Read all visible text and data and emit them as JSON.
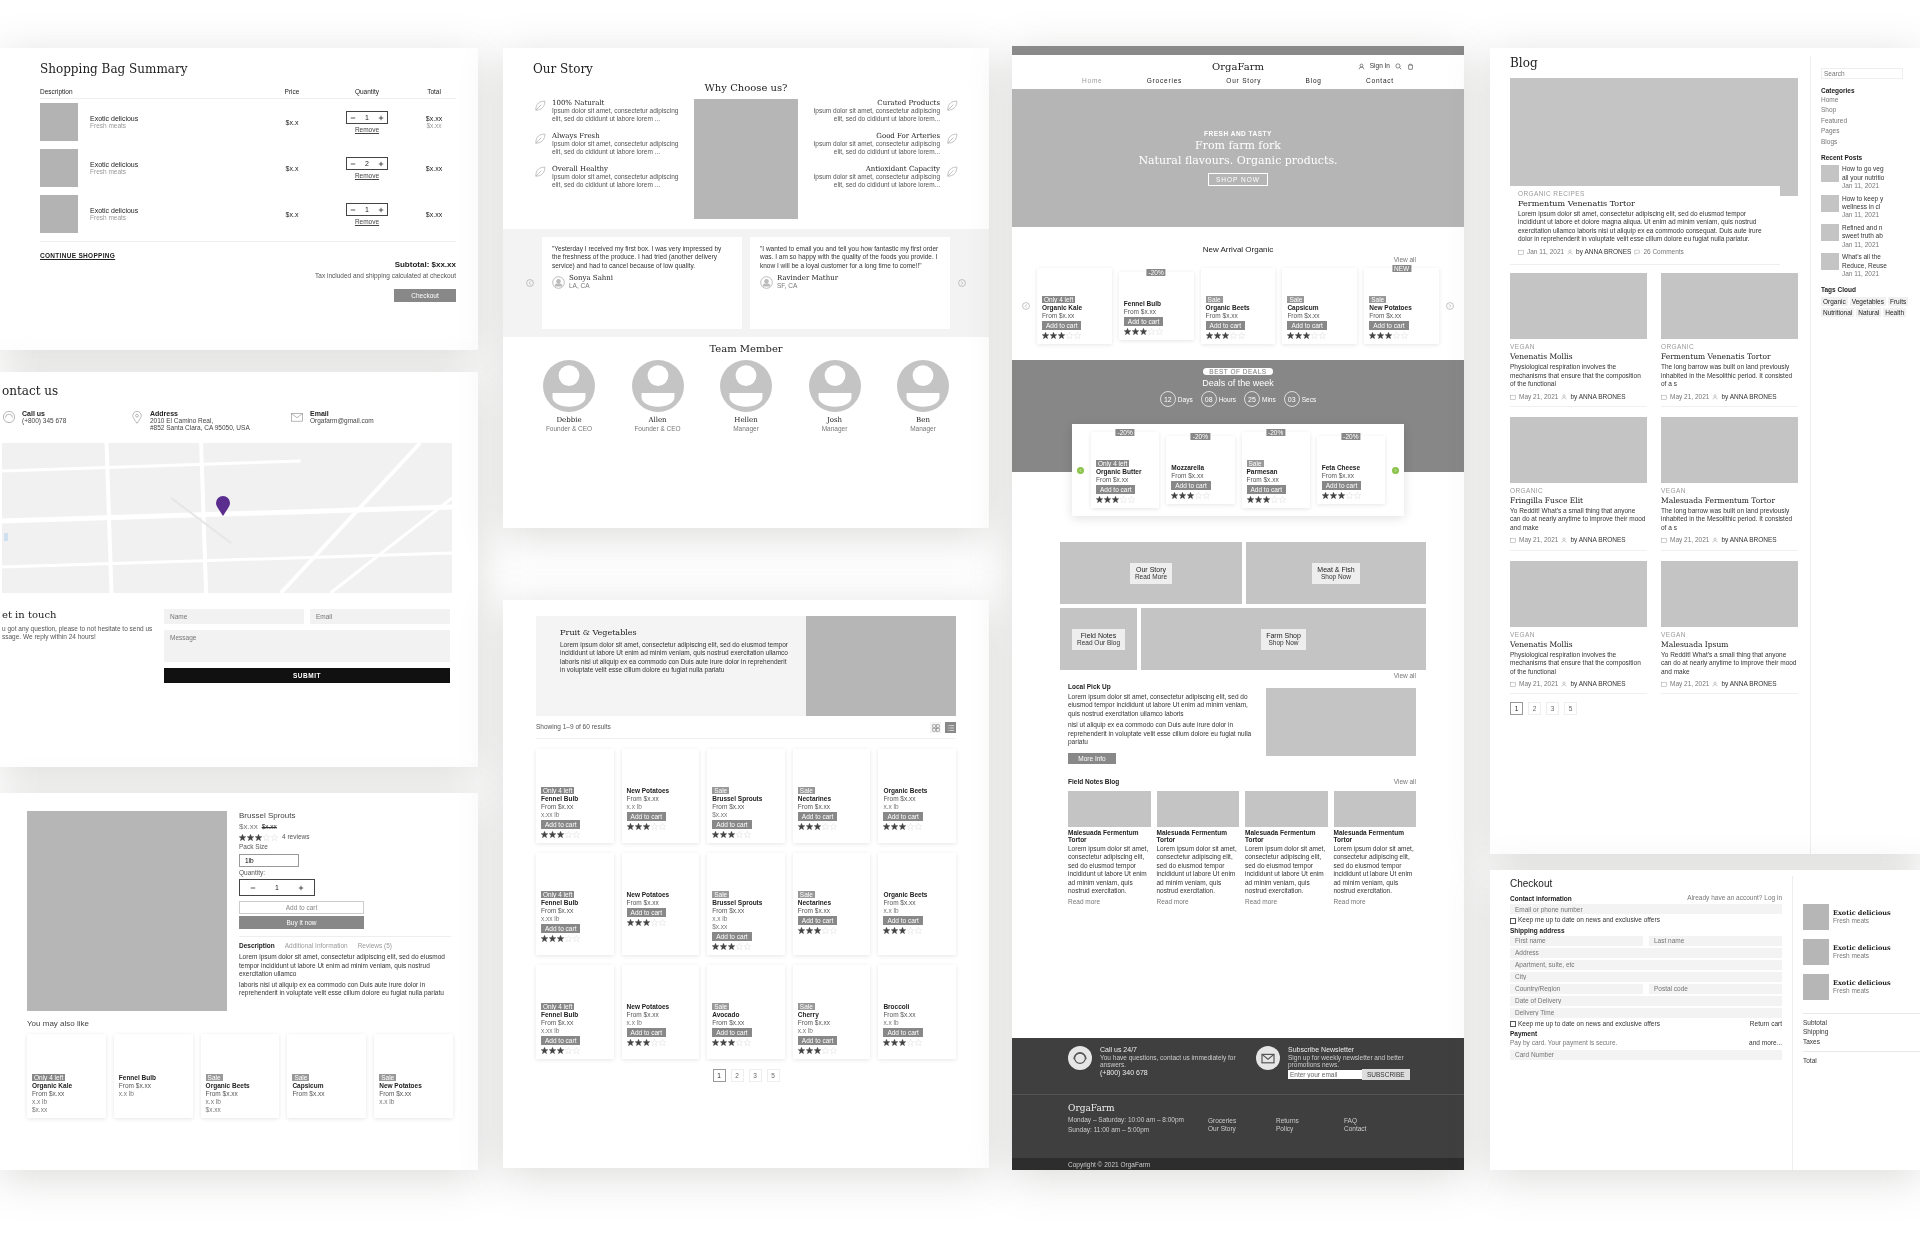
{
  "cart": {
    "title": "Shopping Bag Summary",
    "columns": [
      "Description",
      "Price",
      "Quantity",
      "Total"
    ],
    "items": [
      {
        "name": "Exotic delicious",
        "sub": "Fresh meats",
        "price": "$x.x",
        "qty": "1",
        "remove": "Remove",
        "total": "$x.xx",
        "old": "$x.xx"
      },
      {
        "name": "Exotic delicious",
        "sub": "Fresh meats",
        "price": "$x.x",
        "qty": "2",
        "remove": "Remove",
        "total": "$x.xx"
      },
      {
        "name": "Exotic delicious",
        "sub": "Fresh meats",
        "price": "$x.x",
        "qty": "1",
        "remove": "Remove",
        "total": "$x.xx"
      }
    ],
    "continue": "CONTINUE SHOPPING",
    "subtotal": "Subtotal: $xx.xx",
    "note": "Tax included and shipping calculated at checkout",
    "checkout": "Checkout"
  },
  "contact": {
    "title": "ontact us",
    "infos": [
      {
        "kind": "phone",
        "label": "Call us",
        "lines": [
          "(+800) 345 678"
        ]
      },
      {
        "kind": "pin",
        "label": "Address",
        "lines": [
          "2010 El Camino Real,",
          "#852 Santa Clara, CA 95050, USA"
        ]
      },
      {
        "kind": "mail",
        "label": "Email",
        "lines": [
          "Orgafarm@gmail.com"
        ]
      }
    ],
    "touch_title": "et in touch",
    "touch_text": "u got any question, please to not hesitate to send us ssage. We reply within 24 hours!",
    "name_placeholder": "Name",
    "email_placeholder": "Email",
    "message_placeholder": "Message",
    "submit": "SUBMIT"
  },
  "product": {
    "name": "Brussel Sprouts",
    "price": "$x.xx",
    "old_price": "$x.xx",
    "stars": 3,
    "reviews": "4 reviews",
    "pack_label": "Pack Size",
    "pack_value": "1lb",
    "qty_label": "Quantity:",
    "qty": "1",
    "add": "Add to cart",
    "buy": "Buy it now",
    "tabs": [
      {
        "label": "Description",
        "selected": true
      },
      {
        "label": "Additional Information",
        "selected": false
      },
      {
        "label": "Reviews (5)",
        "selected": false
      }
    ],
    "paragraphs": [
      "Lorem ipsum dolor sit amet, consectetur adipiscing elit, sed do eiusmod tempor incididunt ut labore Ut enim ad minim veniam, quis nostrud exercitation ullamco",
      "laboris nisi ut aliquip ex ea commodo con Duis aute irure dolor in reprehenderit in voluptate velit esse cillum dolore eu fugiat nulla pariatu"
    ],
    "related_title": "You may also like",
    "related": [
      {
        "badge": "Only 4 left",
        "name": "Organic Kale",
        "price": "From $x.xx",
        "weight": "x.x lb",
        "old": "$x.xx"
      },
      {
        "name": "Fennel Bulb",
        "price": "From $x.xx",
        "weight": "x.x lb"
      },
      {
        "badge": "Sale",
        "name": "Organic Beets",
        "price": "From $x.xx",
        "weight": "x.x lb",
        "old": "$x.xx"
      },
      {
        "badge": "Sale",
        "name": "Capsicum",
        "price": "From $x.xx"
      },
      {
        "badge": "Sale",
        "name": "New Potatoes",
        "price": "From $x.xx",
        "weight": "x.x lb"
      }
    ]
  },
  "story": {
    "title": "Our Story",
    "why": "Why  Choose us?",
    "features": [
      {
        "kind": "left",
        "title": "100% Naturalt",
        "text": "Ipsum dolor sit amet, consectetur adipiscing elit, sed do cididunt ut labore lorem ..."
      },
      {
        "kind": "left",
        "title": "Always Fresh",
        "text": "Ipsum dolor sit amet, consectetur adipiscing elit, sed do cididunt ut labore lorem ..."
      },
      {
        "kind": "left",
        "title": "Overall Healthy",
        "text": "Ipsum dolor sit amet, consectetur adipiscing elit, sed do cididunt ut labore lorem ..."
      },
      {
        "kind": "right",
        "title": "Curated Products",
        "text": "Ipsum dolor sit amet, consectetur adipiscing elit, sed do cididunt ut labore lorem..."
      },
      {
        "kind": "right",
        "title": "Good For Arteries",
        "text": "Ipsum dolor sit amet, consectetur adipiscing elit, sed do cididunt ut labore lorem..."
      },
      {
        "kind": "right",
        "title": "Antioxidant Capacity",
        "text": "Ipsum dolor sit amet, consectetur adipiscing elit, sed do cididunt ut labore lorem..."
      }
    ],
    "testimonials": [
      {
        "quote": "\"Yesterday I received my first box. I was very impressed by the freshness of the produce. I had tried (another delivery service) and had to cancel because of low quality.",
        "name": "Sonya Sahni",
        "place": "LA, CA"
      },
      {
        "quote": "\"I wanted to email you and tell you how fantastic my first order was. I am so happy with the quality of the foods you provide. I know I will be a loyal customer for a long time to come!!\"",
        "name": "Ravinder Mathur",
        "place": "SF, CA"
      }
    ],
    "team_title": "Team Member",
    "team": [
      {
        "name": "Debbie",
        "role": "Founder & CEO"
      },
      {
        "name": "Allen",
        "role": "Founder & CEO"
      },
      {
        "name": "Hellen",
        "role": "Manager"
      },
      {
        "name": "Josh",
        "role": "Manager"
      },
      {
        "name": "Ben",
        "role": "Manager"
      }
    ]
  },
  "shop": {
    "banner_title": "Fruit & Vegetables",
    "banner_text": "Lorem ipsum dolor sit amet, consectetur adipiscing elit, sed do eiusmod tempor incididunt ut labore Ut enim ad minim veniam, quis nostrud exercitation ullamco laboris nisi ut aliquip ex ea commodo con Duis aute irure dolor in reprehenderit in voluptate velit esse cillum dolore eu fugiat nulla pariatu",
    "results": "Showing 1–9 of 60 results",
    "views": [
      {
        "kind": "grid",
        "selected": false
      },
      {
        "kind": "list",
        "selected": true
      }
    ],
    "products": [
      {
        "badge": "Only 4 left",
        "name": "Fennel Bulb",
        "price": "From $x.xx",
        "weight": "x.xx lb",
        "button": "Add to cart",
        "stars": 3
      },
      {
        "name": "New Potatoes",
        "price": "From $x.xx",
        "weight": "x.x lb",
        "button": "Add to cart",
        "stars": 3
      },
      {
        "badge": "Sale",
        "name": "Brussel Sprouts",
        "price": "From $x.xx",
        "old": "$x.xx",
        "button": "Add to cart",
        "stars": 3
      },
      {
        "badge": "Sale",
        "name": "Nectarines",
        "price": "From $x.xx",
        "button": "Add to cart",
        "stars": 3
      },
      {
        "name": "Organic Beets",
        "price": "From $x.xx",
        "weight": "x.x lb",
        "button": "Add to cart",
        "stars": 3
      },
      {
        "badge": "Only 4 left",
        "name": "Fennel Bulb",
        "price": "From $x.xx",
        "weight": "x.xx lb",
        "button": "Add to cart",
        "stars": 3
      },
      {
        "name": "New Potatoes",
        "price": "From $x.xx",
        "button": "Add to cart",
        "stars": 3
      },
      {
        "badge": "Sale",
        "name": "Brussel Sprouts",
        "price": "From $x.xx",
        "weight": "x.x lb",
        "old": "$x.xx",
        "button": "Add to cart",
        "stars": 3
      },
      {
        "badge": "Sale",
        "name": "Nectarines",
        "price": "From $x.xx",
        "button": "Add to cart",
        "stars": 3
      },
      {
        "name": "Organic Beets",
        "price": "From $x.xx",
        "weight": "x.x lb",
        "button": "Add to cart",
        "stars": 3
      },
      {
        "badge": "Only 4 left",
        "name": "Fennel Bulb",
        "price": "From $x.xx",
        "weight": "x.xx lb",
        "button": "Add to cart",
        "stars": 3
      },
      {
        "name": "New Potatoes",
        "price": "From $x.xx",
        "weight": "x.x lb",
        "button": "Add to cart",
        "stars": 3
      },
      {
        "badge": "Sale",
        "name": "Avocado",
        "price": "From $x.xx",
        "button": "Add to cart",
        "stars": 3
      },
      {
        "badge": "Sale",
        "name": "Cherry",
        "price": "From $x.xx",
        "weight": "x.x lb",
        "button": "Add to cart",
        "stars": 3
      },
      {
        "name": "Broccoli",
        "price": "From $x.xx",
        "weight": "x.x lb",
        "button": "Add to cart",
        "stars": 3
      }
    ],
    "pages": [
      {
        "label": "1",
        "selected": true
      },
      {
        "label": "2",
        "selected": false
      },
      {
        "label": "3",
        "selected": false
      },
      {
        "label": "5",
        "selected": false
      }
    ]
  },
  "home": {
    "brand": "OrgaFarm",
    "sign_in": "Sign In",
    "nav": [
      {
        "label": "Home",
        "selected": true
      },
      {
        "label": "Groceries",
        "selected": false
      },
      {
        "label": "Our Story",
        "selected": false
      },
      {
        "label": "Blog",
        "selected": false
      },
      {
        "label": "Contact",
        "selected": false
      }
    ],
    "hero_eyebrow": "FRESH AND TASTY",
    "hero_lines": [
      "From farm fork",
      "Natural flavours. Organic products."
    ],
    "hero_button": "SHOP NOW",
    "arrivals_title": "New Arrival Organic",
    "arrivals_view_all": "View all",
    "arrivals": [
      {
        "badge": "Only 4 left",
        "name": "Organic Kale",
        "price": "From $x.xx",
        "button": "Add to cart",
        "stars": 3
      },
      {
        "tag": "-20%",
        "name": "Fennel Bulb",
        "price": "From $x.xx",
        "button": "Add to cart",
        "stars": 3
      },
      {
        "badge": "Sale",
        "name": "Organic Beets",
        "price": "From $x.xx",
        "button": "Add to cart",
        "stars": 3
      },
      {
        "badge": "Sale",
        "name": "Capsicum",
        "price": "From $x.xx",
        "button": "Add to cart",
        "stars": 3
      },
      {
        "badge": "Sale",
        "tag": "NEW",
        "name": "New Potatoes",
        "price": "From $x.xx",
        "button": "Add to cart",
        "stars": 3
      }
    ],
    "deals_pill": "BEST OF DEALS",
    "deals_title": "Deals of the week",
    "countdown": [
      {
        "value": "12",
        "unit": "Days"
      },
      {
        "value": "08",
        "unit": "Hours"
      },
      {
        "value": "25",
        "unit": "Mins"
      },
      {
        "value": "03",
        "unit": "Secs"
      }
    ],
    "deals": [
      {
        "tag": "-20%",
        "badge": "Only 4 left",
        "name": "Organic Butter",
        "price": "From $x.xx",
        "button": "Add to cart",
        "stars": 3
      },
      {
        "tag": "-20%",
        "name": "Mozzarella",
        "price": "From $x.xx",
        "button": "Add to cart",
        "stars": 3
      },
      {
        "tag": "-20%",
        "badge": "Sale",
        "name": "Parmesan",
        "price": "From $x.xx",
        "button": "Add to cart",
        "stars": 3
      },
      {
        "tag": "-20%",
        "name": "Feta Cheese",
        "price": "From $x.xx",
        "button": "Add to cart",
        "stars": 3
      }
    ],
    "tiles": [
      {
        "title": "Our Story",
        "sub": "Read More"
      },
      {
        "title": "Meat & Fish",
        "sub": "Shop Now"
      },
      {
        "title": "Field Notes",
        "sub": "Read Our Blog"
      },
      {
        "title": "Farm Shop",
        "sub": "Shop Now"
      }
    ],
    "tiles_view_all": "View all",
    "pickup_title": "Local Pick Up",
    "pickup_paragraphs": [
      "Lorem ipsum dolor sit amet, consectetur adipiscing elit, sed do eiusmod tempor incididunt ut labore Ut enim ad minim veniam, quis nostrud exercitation ullamco laboris",
      "nisi ut aliquip ex ea commodo con Duis aute irure dolor in reprehenderit in voluptate velit esse cillum dolore eu fugiat nulla pariatu"
    ],
    "pickup_button": "More Info",
    "blog_title": "Field Notes Blog",
    "blog_view_all": "View all",
    "posts": [
      {
        "title": "Malesuada Fermentum Tortor",
        "text": "Lorem ipsum dolor sit amet, consectetur adipiscing elit, sed do eiusmod tempor incididunt ut labore Ut enim ad minim veniam, quis nostrud exercitation.",
        "read_more": "Read more"
      },
      {
        "title": "Malesuada Fermentum Tortor",
        "text": "Lorem ipsum dolor sit amet, consectetur adipiscing elit, sed do eiusmod tempor incididunt ut labore Ut enim ad minim veniam, quis nostrud exercitation.",
        "read_more": "Read more"
      },
      {
        "title": "Malesuada Fermentum Tortor",
        "text": "Lorem ipsum dolor sit amet, consectetur adipiscing elit, sed do eiusmod tempor incididunt ut labore Ut enim ad minim veniam, quis nostrud exercitation.",
        "read_more": "Read more"
      },
      {
        "title": "Malesuada Fermentum Tortor",
        "text": "Lorem ipsum dolor sit amet, consectetur adipiscing elit, sed do eiusmod tempor incididunt ut labore Ut enim ad minim veniam, quis nostrud exercitation.",
        "read_more": "Read more"
      }
    ],
    "call_title": "Call us 24/7",
    "call_text": "You have questions, contact us immediately for answers.",
    "call_phone": "(+800) 340 678",
    "news_title": "Subscribe Newsletter",
    "news_text": "Sign up for weekly newsletter and better promotions news.",
    "news_placeholder": "Enter your email",
    "news_button": "SUBSCRIBE",
    "footer_brand": "OrgaFarm",
    "hours": [
      "Monday – Saturday: 10:00 am – 8:00pm",
      "Sunday: 11:00 am – 5:00pm"
    ],
    "link_columns": [
      [
        "Groceries",
        "Our Story"
      ],
      [
        "Returns",
        "Policy"
      ],
      [
        "FAQ",
        "Contact"
      ]
    ],
    "copyright": "Copyright © 2021 OrgaFarm"
  },
  "blog": {
    "title": "Blog",
    "featured": {
      "category": "ORGANIC RECIPES",
      "title": "Fermentum Venenatis Tortor",
      "text": "Lorem ipsum dolor sit amet, consectetur adipiscing elit, sed do eiusmod tempor incididunt ut labore et dolore magna aliqua. Ut enim ad minim veniam, quis nostrud exercitation ullamco laboris nisi ut aliquip ex ea commodo consequat. Duis aute irure dolor in reprehenderit in voluptate velit esse cillum dolore eu fugiat nulla pariatur.",
      "date": "Jan 11, 2021",
      "author": "by ANNA BRONES",
      "comments": "26 Comments"
    },
    "posts": [
      {
        "category": "VEGAN",
        "title": "Venenatis Mollis",
        "text": "Physiological respiration involves the mechanisms that ensure that the composition of the functional",
        "date": "May 21, 2021",
        "author": "by ANNA BRONES"
      },
      {
        "category": "ORGANIC",
        "title": "Fermentum Venenatis Tortor",
        "text": "The long barrow was built on land previously inhabited in the Mesolithic period. It consisted of a s",
        "date": "May 21, 2021",
        "author": "by ANNA BRONES"
      },
      {
        "category": "ORGANIC",
        "title": "Fringilla Fusce Elit",
        "text": "Yo Reddit! What's a small thing that anyone can do at nearly anytime to improve their mood and make",
        "date": "May 21, 2021",
        "author": "by ANNA BRONES"
      },
      {
        "category": "VEGAN",
        "title": "Malesuada Fermentum Tortor",
        "text": "The long barrow was built on land previously inhabited in the Mesolithic period. It consisted of a s",
        "date": "May 21, 2021",
        "author": "by ANNA BRONES"
      },
      {
        "category": "VEGAN",
        "title": "Venenatis Mollis",
        "text": "Physiological respiration involves the mechanisms that ensure that the composition of the functional",
        "date": "May 21, 2021",
        "author": "by ANNA BRONES"
      },
      {
        "category": "VEGAN",
        "title": "Malesuada Ipsum",
        "text": "Yo Reddit! What's a small thing that anyone can do at nearly anytime to improve their mood and make",
        "date": "May 21, 2021",
        "author": "by ANNA BRONES"
      }
    ],
    "pages": [
      {
        "label": "1",
        "selected": true
      },
      {
        "label": "2",
        "selected": false
      },
      {
        "label": "3",
        "selected": false
      },
      {
        "label": "5",
        "selected": false
      }
    ],
    "search_placeholder": "Search",
    "categories_title": "Categories",
    "categories": [
      "Home",
      "Shop",
      "Featured",
      "Pages",
      "Blogs"
    ],
    "recent_title": "Recent Posts",
    "recent": [
      {
        "title": "How to go veg",
        "title2": "all your nutritio",
        "date": "Jan 11, 2021"
      },
      {
        "title": "How to keep y",
        "title2": "wellness in cl",
        "date": "Jan 11, 2021"
      },
      {
        "title": "Refined and n",
        "title2": "sweet truth ab",
        "date": "Jan 11, 2021"
      },
      {
        "title": "What's all the",
        "title2": "Reduce, Reuse",
        "date": "Jan 11, 2021"
      }
    ],
    "tags_title": "Tags Cloud",
    "tags": [
      "Organic",
      "Vegetables",
      "Fruits",
      "Nutritional",
      "Natural",
      "Health"
    ]
  },
  "checkout": {
    "title": "Checkout",
    "contact_title": "Contact information",
    "account": "Already have an account? Log in",
    "email_placeholder": "Email or phone number",
    "news_check": {
      "label": "Keep me up to date on news and exclusive offers",
      "checked": false
    },
    "shipping_title": "Shipping address",
    "first_placeholder": "First name",
    "last_placeholder": "Last name",
    "address_placeholder": "Address",
    "apartment_placeholder": "Apartment, suite, etc",
    "city_placeholder": "City",
    "country_placeholder": "Country/Region",
    "postal_placeholder": "Postal code",
    "date_placeholder": "Date of Delivery",
    "time_placeholder": "Delivery Time",
    "news_check2": {
      "label": "Keep me up to date on news and exclusive offers",
      "checked": false
    },
    "return": "Return cart",
    "payment_title": "Payment",
    "payment_note": "Pay by card. Your payment is secure.",
    "more": "and more...",
    "card_placeholder": "Card Number",
    "items": [
      {
        "name": "Exotic delicious",
        "sub": "Fresh meats"
      },
      {
        "name": "Exotic delicious",
        "sub": "Fresh meats"
      },
      {
        "name": "Exotic delicious",
        "sub": "Fresh meats"
      }
    ],
    "totals": [
      "Subtotal",
      "Shipping",
      "Taxes"
    ],
    "total": "Total"
  }
}
